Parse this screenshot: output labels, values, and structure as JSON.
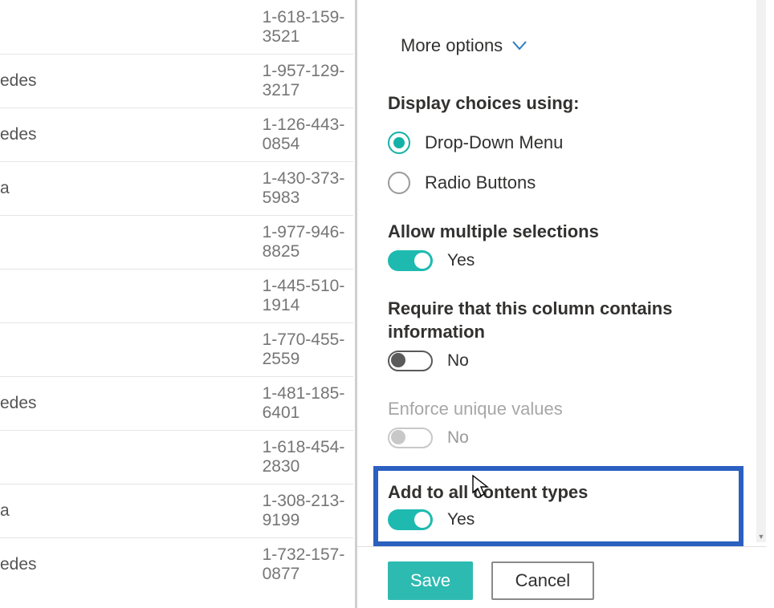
{
  "list_rows": [
    {
      "name": "",
      "phone": "1-618-159-3521"
    },
    {
      "name": "edes",
      "phone": "1-957-129-3217"
    },
    {
      "name": "edes",
      "phone": "1-126-443-0854"
    },
    {
      "name": "a",
      "phone": "1-430-373-5983"
    },
    {
      "name": "",
      "phone": "1-977-946-8825"
    },
    {
      "name": "",
      "phone": "1-445-510-1914"
    },
    {
      "name": "",
      "phone": "1-770-455-2559"
    },
    {
      "name": "edes",
      "phone": "1-481-185-6401"
    },
    {
      "name": "",
      "phone": "1-618-454-2830"
    },
    {
      "name": "a",
      "phone": "1-308-213-9199"
    },
    {
      "name": "edes",
      "phone": "1-732-157-0877"
    }
  ],
  "panel": {
    "more_options": "More options",
    "display_choices_label": "Display choices using:",
    "radio_drop_down": "Drop-Down Menu",
    "radio_buttons": "Radio Buttons",
    "allow_multi_label": "Allow multiple selections",
    "allow_multi_value": "Yes",
    "require_label": "Require that this column contains information",
    "require_value": "No",
    "unique_label": "Enforce unique values",
    "unique_value": "No",
    "addtypes_label": "Add to all content types",
    "addtypes_value": "Yes",
    "save": "Save",
    "cancel": "Cancel"
  }
}
